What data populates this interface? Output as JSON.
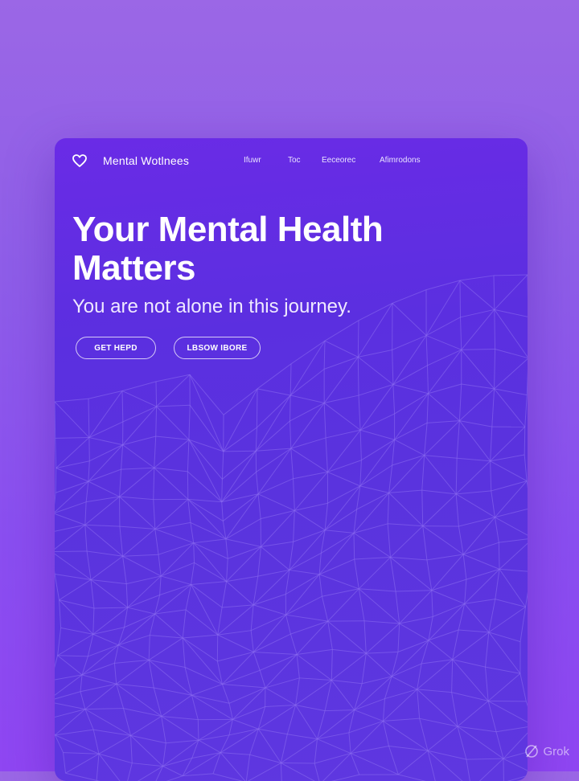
{
  "header": {
    "brand": "Mental Wotlnees",
    "nav": [
      "Ifuwr",
      "Toc",
      "Eeceorec",
      "Afimrodons"
    ]
  },
  "hero": {
    "title": "Your Mental Health Matters",
    "subtitle": "You are not alone in this journey.",
    "primary_button": "GET HEPD",
    "secondary_button": "LBSOW IBORE"
  },
  "watermark": "Grok",
  "icons": [
    "heart-logo-icon",
    "grok-logo-icon"
  ],
  "colors": {
    "page_background": "#9b67e6",
    "card_background": "#5b2fe0",
    "mesh_line": "#8d6ef0",
    "text": "#ffffff"
  }
}
